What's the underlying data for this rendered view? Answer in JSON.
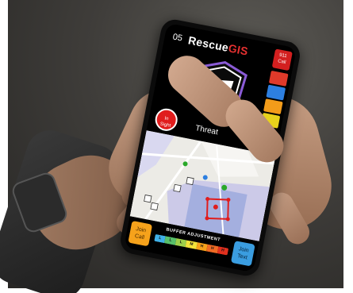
{
  "app": {
    "screen_number": "05",
    "logo_main": "Rescue",
    "logo_accent": "GIS"
  },
  "header": {
    "sos_line1": "911",
    "sos_line2": "Call"
  },
  "side_column": {
    "cells": [
      {
        "label": "",
        "color": "#e03a2a"
      },
      {
        "label": "",
        "color": "#2d7fe0"
      },
      {
        "label": "",
        "color": "#f39c1a"
      },
      {
        "label": "",
        "color": "#e8d21b"
      }
    ]
  },
  "status": {
    "insight_line1": "In",
    "insight_line2": "Sight",
    "threat_label": "Threat",
    "green_button": "Cl"
  },
  "bottom": {
    "join_call_line1": "Join",
    "join_call_line2": "Call",
    "buffer_title": "BUFFER ADJUSTMENT",
    "scale": [
      "L",
      "L",
      "L",
      "M",
      "H",
      "H",
      "H"
    ],
    "join_text_line1": "Join",
    "join_text_line2": "Text"
  },
  "colors": {
    "brand_red": "#e53030",
    "join_call": "#f6a21b",
    "join_text": "#3a9de0",
    "insight": "#e01d1d",
    "green": "#3cbf3c"
  }
}
